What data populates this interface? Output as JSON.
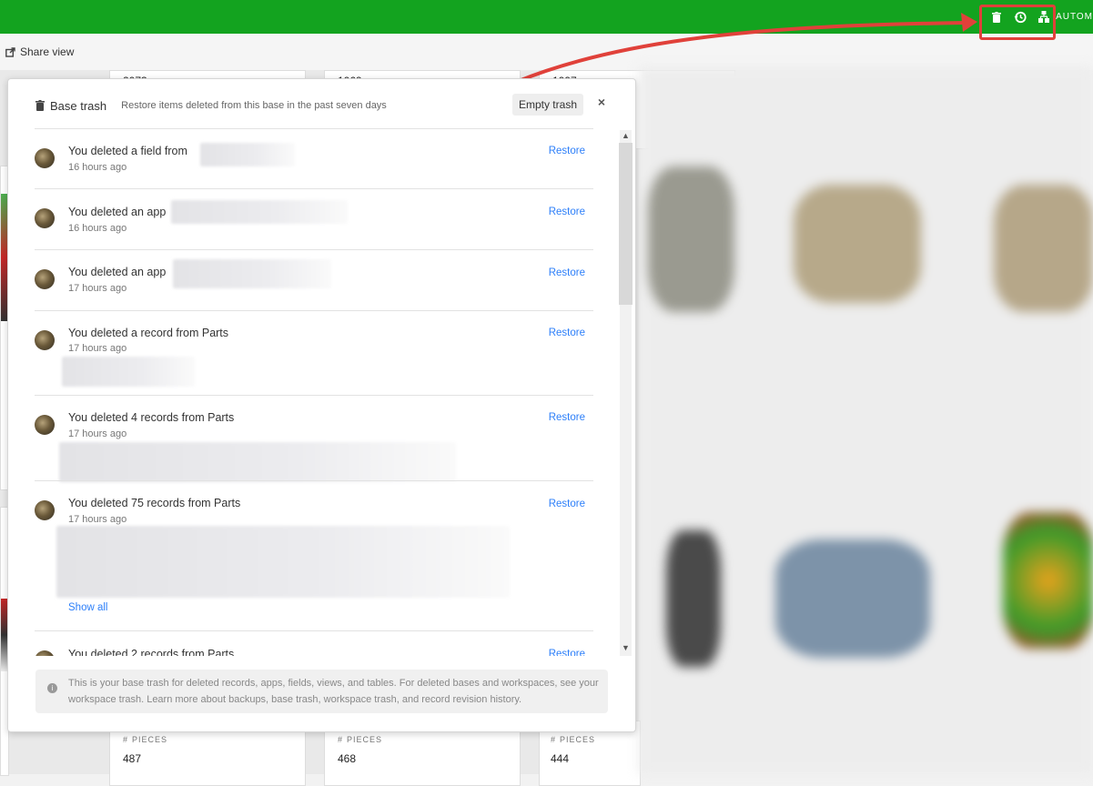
{
  "toolbar": {
    "share_view_label": "Share view",
    "automations_label": "AUTOM"
  },
  "gallery": {
    "pieces_label": "PIECES",
    "top_values": [
      "2073",
      "1069",
      "1097"
    ],
    "bottom_values": [
      "487",
      "468",
      "444"
    ]
  },
  "trash": {
    "title": "Base trash",
    "subtitle": "Restore items deleted from this base in the past seven days",
    "empty_label": "Empty trash",
    "close_symbol": "×",
    "restore_label": "Restore",
    "show_all_label": "Show all",
    "items": [
      {
        "text": "You deleted a field from",
        "time": "16 hours ago"
      },
      {
        "text": "You deleted an app",
        "time": "16 hours ago"
      },
      {
        "text": "You deleted an app",
        "time": "17 hours ago"
      },
      {
        "text": "You deleted a record from Parts",
        "time": "17 hours ago"
      },
      {
        "text": "You deleted 4 records from Parts",
        "time": "17 hours ago"
      },
      {
        "text": "You deleted 75 records from Parts",
        "time": "17 hours ago"
      },
      {
        "text": "You deleted 2 records from Parts",
        "time": ""
      }
    ],
    "footer_note": "This is your base trash for deleted records, apps, fields, views, and tables. For deleted bases and workspaces, see your workspace trash. Learn more about backups, base trash, workspace trash, and record revision history."
  },
  "colors": {
    "topbar": "#13a31f",
    "link": "#2d7ff9",
    "highlight": "#e0413a"
  },
  "icons": [
    "trash-icon",
    "history-icon",
    "automations-icon",
    "share-icon",
    "info-icon",
    "hash-icon"
  ]
}
